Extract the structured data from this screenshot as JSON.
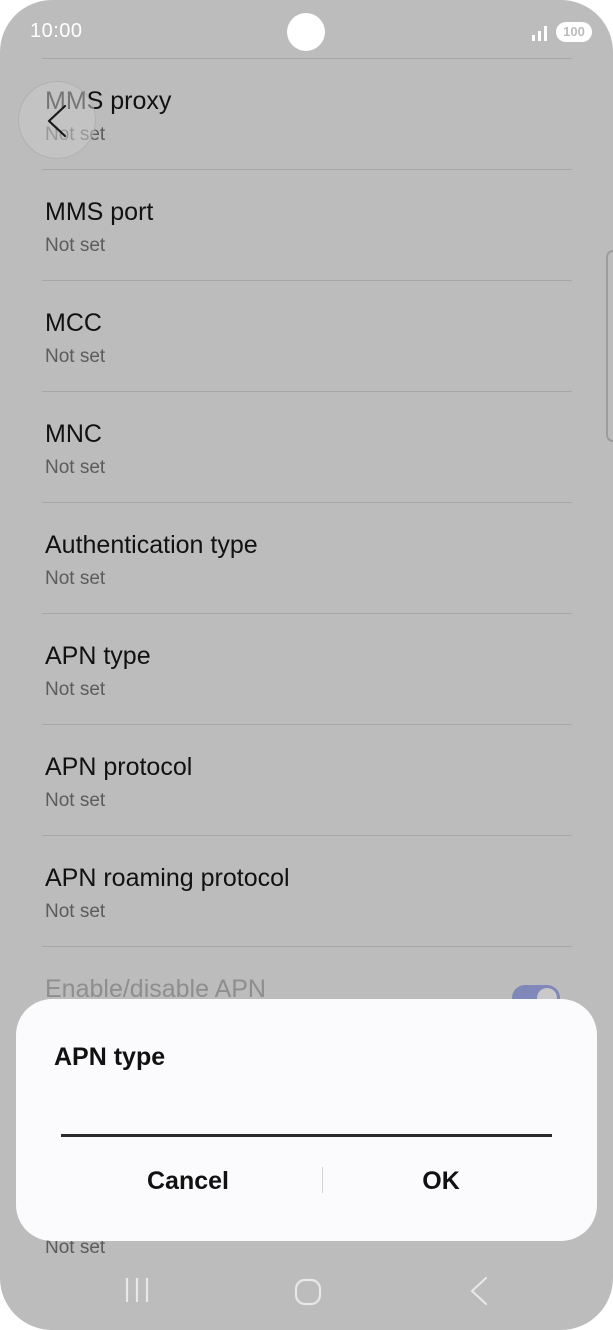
{
  "status_bar": {
    "time": "10:00",
    "battery": "100"
  },
  "settings": {
    "items": [
      {
        "title": "MMS proxy",
        "value": "Not set"
      },
      {
        "title": "MMS port",
        "value": "Not set"
      },
      {
        "title": "MCC",
        "value": "Not set"
      },
      {
        "title": "MNC",
        "value": "Not set"
      },
      {
        "title": "Authentication type",
        "value": "Not set"
      },
      {
        "title": "APN type",
        "value": "Not set"
      },
      {
        "title": "APN protocol",
        "value": "Not set"
      },
      {
        "title": "APN roaming protocol",
        "value": "Not set"
      },
      {
        "title": "Enable/disable APN",
        "toggle": true
      }
    ],
    "hidden_item_value": "Not set"
  },
  "dialog": {
    "title": "APN type",
    "input_value": "",
    "cancel_label": "Cancel",
    "ok_label": "OK"
  },
  "icons": {
    "back": "chevron-left-icon",
    "signal": "signal-icon",
    "nav_recents": "recents-icon",
    "nav_home": "home-icon",
    "nav_back": "back-icon"
  },
  "colors": {
    "scrim": "#bcbcbc",
    "dialog_bg": "#fbfbfd",
    "toggle_on": "#7f88b8"
  }
}
